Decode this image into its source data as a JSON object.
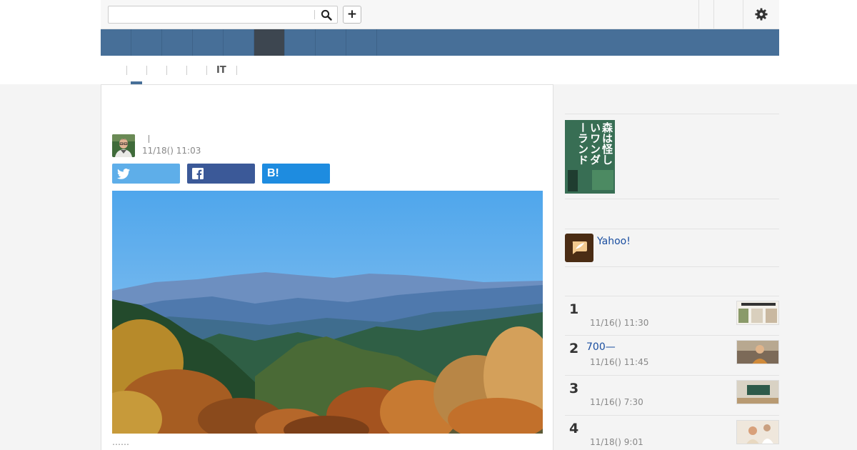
{
  "header": {
    "search": {
      "placeholder": "",
      "value": ""
    },
    "plus_label": "+",
    "icons": {
      "search": "search-icon",
      "gear": "gear-icon",
      "plus": "plus-icon"
    }
  },
  "global_nav": {
    "items": [
      {
        "label": "",
        "active": false
      },
      {
        "label": "",
        "active": false
      },
      {
        "label": "",
        "active": false
      },
      {
        "label": "",
        "active": false
      },
      {
        "label": "",
        "active": false
      },
      {
        "label": "",
        "active": true
      },
      {
        "label": "",
        "active": false
      },
      {
        "label": "",
        "active": false
      },
      {
        "label": "",
        "active": false
      }
    ]
  },
  "sub_nav": {
    "items": [
      {
        "label": "",
        "active": true
      },
      {
        "label": "",
        "active": false
      },
      {
        "label": "",
        "active": false
      },
      {
        "label": "",
        "active": false
      },
      {
        "label": "IT",
        "active": false
      },
      {
        "label": "",
        "active": false
      }
    ]
  },
  "article": {
    "title": "",
    "author_name": "",
    "date": "11/18() 11:03",
    "share": {
      "twitter": "",
      "facebook": "",
      "hatena": "B!"
    },
    "caption": "……"
  },
  "sidebar": {
    "book_title": "森は怪しいワンダーランド",
    "yahoo_label": "Yahoo!",
    "ranking": [
      {
        "rank": "1",
        "title": "",
        "date": "11/16() 11:30"
      },
      {
        "rank": "2",
        "title": "700—",
        "date": "11/16() 11:45"
      },
      {
        "rank": "3",
        "title": "",
        "date": "11/16() 7:30"
      },
      {
        "rank": "4",
        "title": "",
        "date": "11/18() 9:01"
      }
    ]
  },
  "colors": {
    "nav_blue": "#476f98",
    "nav_active": "#3d4650",
    "twitter": "#5eaee9",
    "facebook": "#3b5998",
    "hatena": "#1e8ce0",
    "link": "#1a4ea0"
  }
}
